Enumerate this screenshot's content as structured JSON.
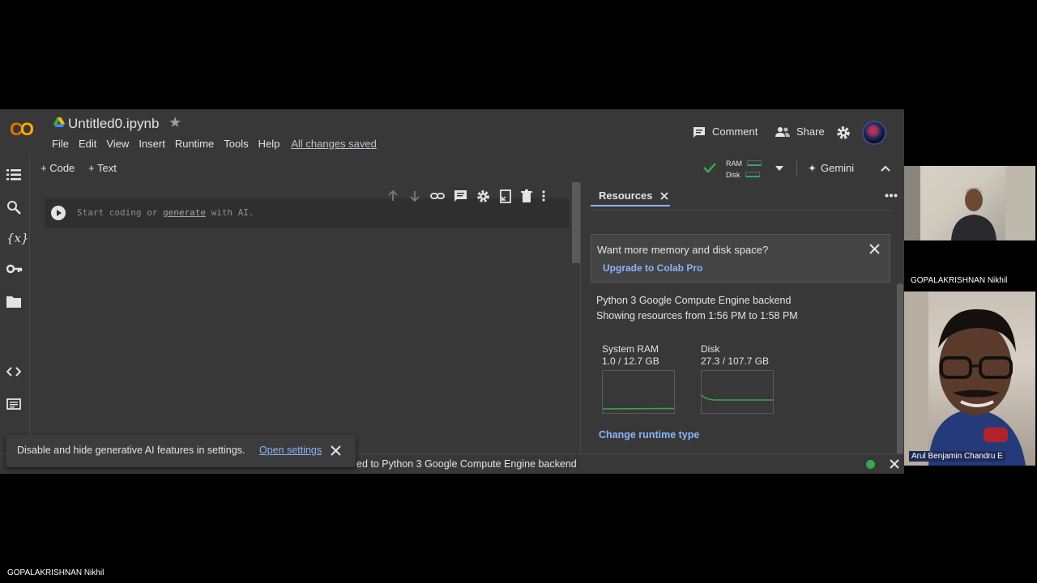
{
  "colors": {
    "accent": "#8ab4f8",
    "bg": "#383838",
    "green": "#34a853",
    "logo_orange": "#f9ab00"
  },
  "header": {
    "logo": "CO",
    "title": "Untitled0.ipynb",
    "menu": [
      "File",
      "Edit",
      "View",
      "Insert",
      "Runtime",
      "Tools",
      "Help"
    ],
    "saved_status": "All changes saved",
    "comment_label": "Comment",
    "share_label": "Share"
  },
  "toolbar": {
    "code_label": "+ Code",
    "text_label": "+ Text",
    "ram_label": "RAM",
    "disk_label": "Disk",
    "gemini_label": "Gemini"
  },
  "cell": {
    "placeholder_start": "Start coding or ",
    "placeholder_link": "generate",
    "placeholder_end": " with AI."
  },
  "panel": {
    "tab_label": "Resources",
    "promo_title": "Want more memory and disk space?",
    "promo_link": "Upgrade to Colab Pro",
    "backend": "Python 3 Google Compute Engine backend",
    "showing": "Showing resources from 1:56 PM to 1:58 PM",
    "ram": {
      "label": "System RAM",
      "value": "1.0 / 12.7 GB"
    },
    "disk": {
      "label": "Disk",
      "value": "27.3 / 107.7 GB"
    },
    "change_runtime": "Change runtime type"
  },
  "status": {
    "text": "ed to Python 3 Google Compute Engine backend"
  },
  "snackbar": {
    "text": "Disable and hide generative AI features in settings.",
    "link": "Open settings"
  },
  "participants": {
    "top_name": "GOPALAKRISHNAN Nikhil",
    "tile2_name": "Arul Benjamin Chandru E",
    "bottom_name": "GOPALAKRISHNAN Nikhil"
  },
  "icons": [
    "drive-icon",
    "star-icon",
    "comment-icon",
    "share-icon",
    "settings-icon",
    "toc-icon",
    "search-icon",
    "variables-icon",
    "key-icon",
    "folder-icon",
    "code-icon",
    "terminal-icon",
    "check-icon",
    "gemini-icon",
    "collapse-icon",
    "run-icon",
    "close-icon",
    "more-icon"
  ]
}
